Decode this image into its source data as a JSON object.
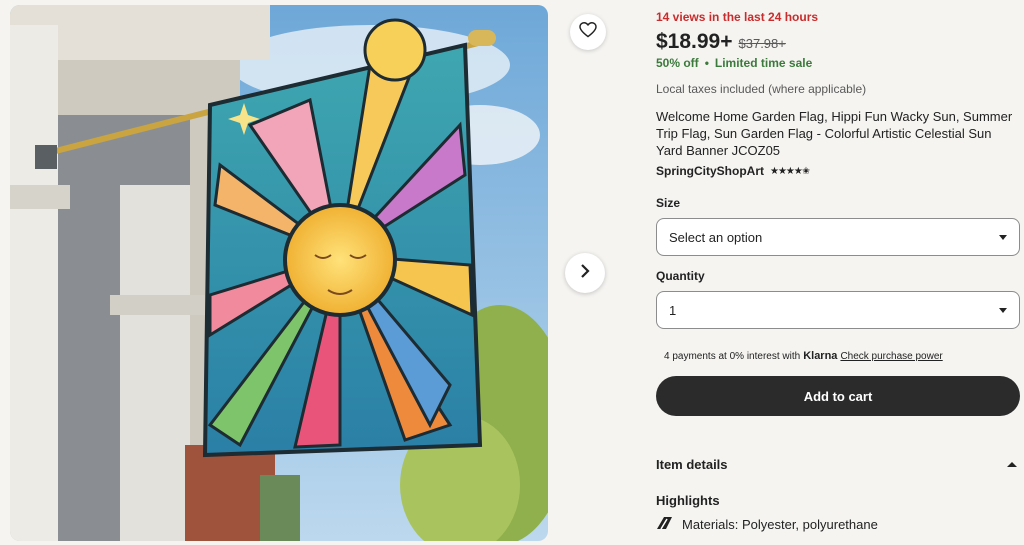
{
  "listing": {
    "views_text": "14 views in the last 24 hours",
    "price": "$18.99+",
    "original_price": "$37.98+",
    "discount": "50% off",
    "separator": "•",
    "sale_label": "Limited time sale",
    "taxes_note": "Local taxes included (where applicable)",
    "title": "Welcome Home Garden Flag, Hippi Fun Wacky Sun, Summer Trip Flag, Sun Garden Flag - Colorful Artistic Celestial Sun Yard Banner JCOZ05",
    "shop_name": "SpringCityShopArt",
    "rating_stars": "★★★★✬"
  },
  "options": {
    "size_label": "Size",
    "size_value": "Select an option",
    "quantity_label": "Quantity",
    "quantity_value": "1"
  },
  "payment": {
    "klarna_prefix": "4 payments at 0% interest with",
    "klarna_brand": "Klarna",
    "klarna_link": "Check purchase power"
  },
  "actions": {
    "add_to_cart": "Add to cart"
  },
  "details": {
    "header": "Item details",
    "highlights": "Highlights",
    "materials": "Materials: Polyester, polyurethane"
  },
  "icons": {
    "favorite": "heart-icon",
    "next": "chevron-right-icon",
    "collapse": "chevron-up-icon",
    "materials": "materials-icon"
  }
}
